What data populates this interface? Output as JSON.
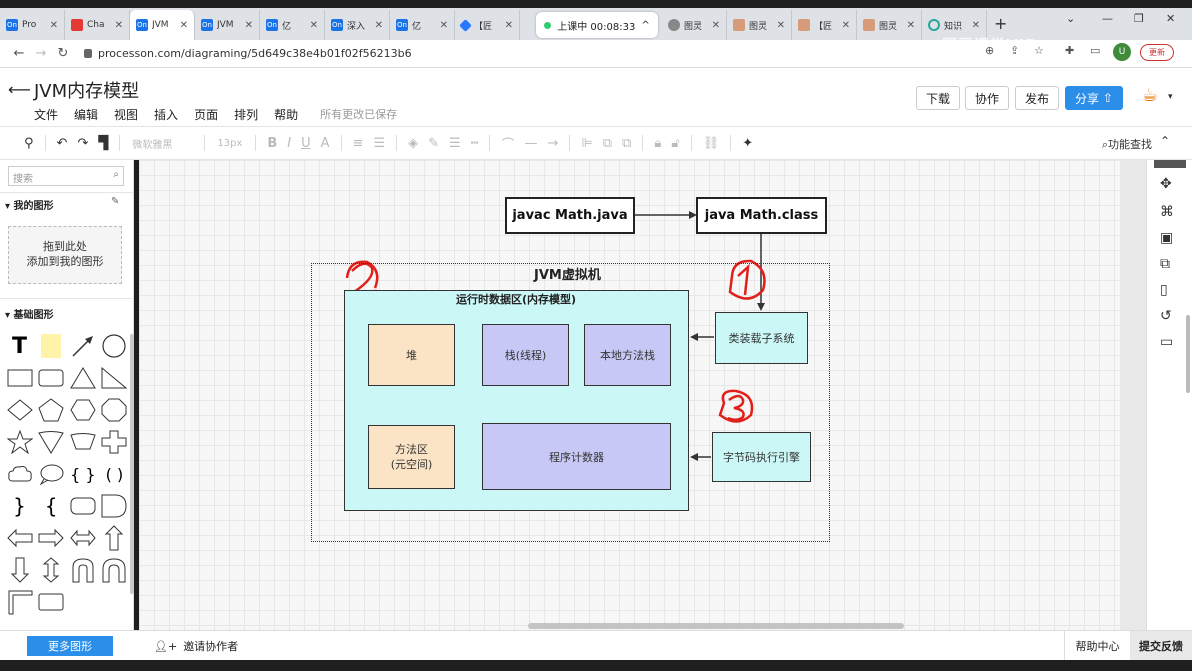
{
  "browser": {
    "tabs": [
      {
        "title": "Pro",
        "fav": "On",
        "kind": "on"
      },
      {
        "title": "Cha",
        "fav": "",
        "kind": "red"
      },
      {
        "title": "JVM",
        "fav": "On",
        "kind": "on",
        "active": true
      },
      {
        "title": "JVM",
        "fav": "On",
        "kind": "on"
      },
      {
        "title": "亿",
        "fav": "On",
        "kind": "on"
      },
      {
        "title": "深入",
        "fav": "On",
        "kind": "on"
      },
      {
        "title": "亿",
        "fav": "On",
        "kind": "on"
      },
      {
        "title": "【匠",
        "fav": "",
        "kind": "blue2"
      }
    ],
    "rec_tab": "上课中 00:08:33",
    "tabs_right": [
      {
        "title": "图灵",
        "kind": "web"
      },
      {
        "title": "图灵",
        "kind": "img"
      },
      {
        "title": "【匠",
        "kind": "img"
      },
      {
        "title": "图灵",
        "kind": "img"
      },
      {
        "title": "知识",
        "kind": "cir"
      }
    ],
    "url": "processon.com/diagraming/5d649c38e4b01f02f56213b6",
    "avatar": "U",
    "pill": "更新",
    "watermark": "图灵课堂VIP"
  },
  "app": {
    "title": "JVM内存模型",
    "menu": [
      "文件",
      "编辑",
      "视图",
      "插入",
      "页面",
      "排列",
      "帮助"
    ],
    "saved": "所有更改已保存",
    "buttons": {
      "download": "下载",
      "collab": "协作",
      "publish": "发布",
      "share": "分享"
    }
  },
  "toolbar": {
    "font": "微软雅黑",
    "size": "13px",
    "func_find": "功能查找"
  },
  "sidebar": {
    "search_placeholder": "搜索",
    "my_shapes": "我的图形",
    "drop_line1": "拖到此处",
    "drop_line2": "添加到我的图形",
    "basic_shapes": "基础图形"
  },
  "bottom": {
    "more_shapes": "更多图形",
    "invite": "邀请协作者",
    "help": "帮助中心",
    "feedback": "提交反馈"
  },
  "diagram": {
    "javac": "javac Math.java",
    "java": "java Math.class",
    "jvm_title": "JVM虚拟机",
    "runtime_title": "运行时数据区(内存模型)",
    "classloader": "类装载子系统",
    "engine": "字节码执行引擎",
    "heap": "堆",
    "stack": "栈(线程)",
    "native_stack": "本地方法栈",
    "method_area_1": "方法区",
    "method_area_2": "(元空间)",
    "pc": "程序计数器",
    "annotations": [
      "2",
      "1",
      "3"
    ]
  },
  "colors": {
    "accent": "#2b8ee8",
    "cyan": "#ccf7f7",
    "tan": "#fbe3c5",
    "lavender": "#c8c8f7",
    "annotation_red": "#e0201b"
  }
}
